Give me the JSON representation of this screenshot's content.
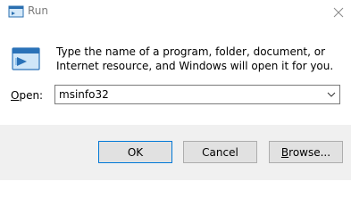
{
  "window": {
    "title": "Run",
    "title_icon": "run-icon",
    "close_icon": "close-icon"
  },
  "content": {
    "description": "Type the name of a program, folder, document, or Internet resource, and Windows will open it for you.",
    "icon": "run-large-icon",
    "open_label_accel": "O",
    "open_label_rest": "pen:",
    "open_value": "msinfo32",
    "dropdown_icon": "chevron-down-icon"
  },
  "buttons": {
    "ok_label": "OK",
    "cancel_label": "Cancel",
    "browse_accel": "B",
    "browse_rest": "rowse..."
  },
  "colors": {
    "footer_bg": "#f0f0f0",
    "button_bg": "#e1e1e1",
    "default_button_border": "#0078d7",
    "title_text": "#7a7a7a"
  }
}
